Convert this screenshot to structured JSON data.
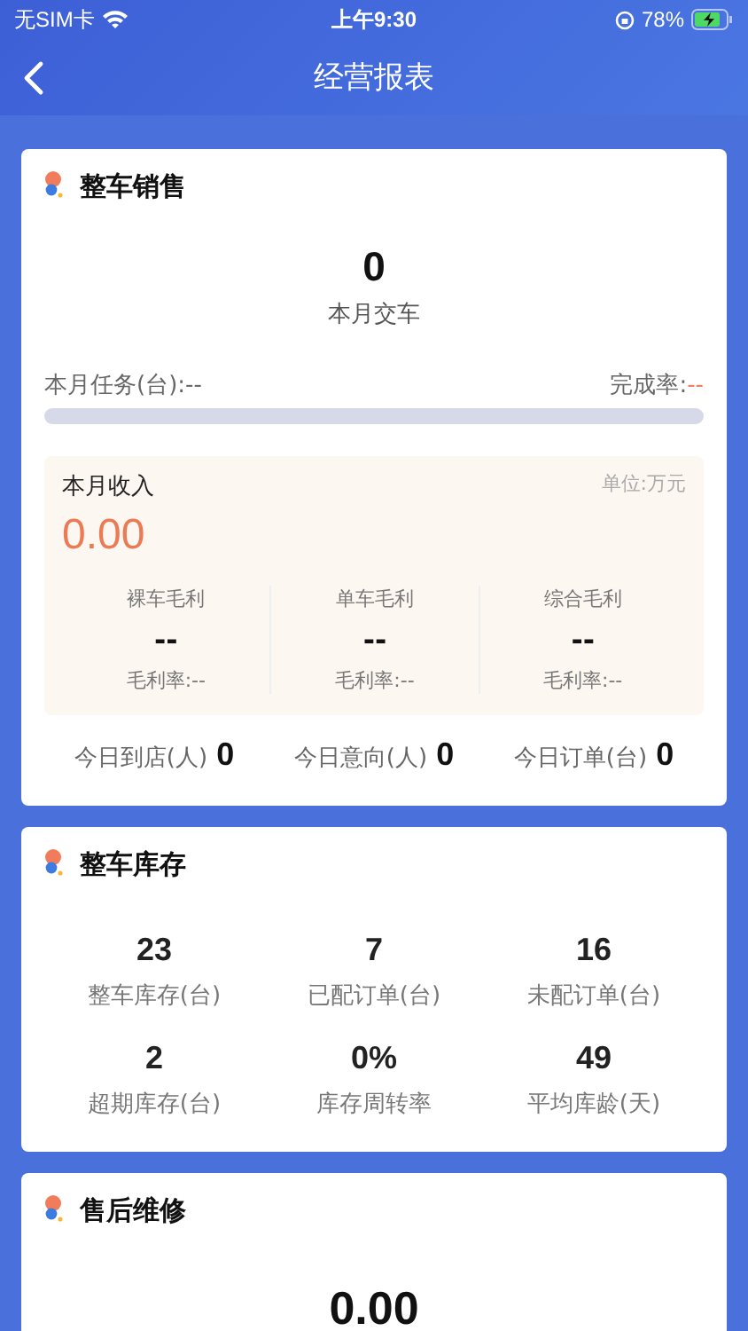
{
  "status_bar": {
    "carrier": "无SIM卡",
    "time": "上午9:30",
    "battery": "78%"
  },
  "nav": {
    "title": "经营报表"
  },
  "sales": {
    "title": "整车销售",
    "delivered_value": "0",
    "delivered_label": "本月交车",
    "task_label": "本月任务(台):--",
    "rate_label": "完成率:",
    "rate_value": "--",
    "level": 0,
    "income": {
      "title": "本月收入",
      "unit": "单位:万元",
      "value": "0.00",
      "profits": [
        {
          "label": "裸车毛利",
          "value": "--",
          "rate": "毛利率:--"
        },
        {
          "label": "单车毛利",
          "value": "--",
          "rate": "毛利率:--"
        },
        {
          "label": "综合毛利",
          "value": "--",
          "rate": "毛利率:--"
        }
      ]
    },
    "today": [
      {
        "label": "今日到店(人)",
        "value": "0"
      },
      {
        "label": "今日意向(人)",
        "value": "0"
      },
      {
        "label": "今日订单(台)",
        "value": "0"
      }
    ]
  },
  "inventory": {
    "title": "整车库存",
    "stats": [
      {
        "value": "23",
        "label": "整车库存(台)"
      },
      {
        "value": "7",
        "label": "已配订单(台)"
      },
      {
        "value": "16",
        "label": "未配订单(台)"
      },
      {
        "value": "2",
        "label": "超期库存(台)"
      },
      {
        "value": "0%",
        "label": "库存周转率"
      },
      {
        "value": "49",
        "label": "平均库龄(天)"
      }
    ]
  },
  "service": {
    "title": "售后维修",
    "value": "0.00"
  }
}
